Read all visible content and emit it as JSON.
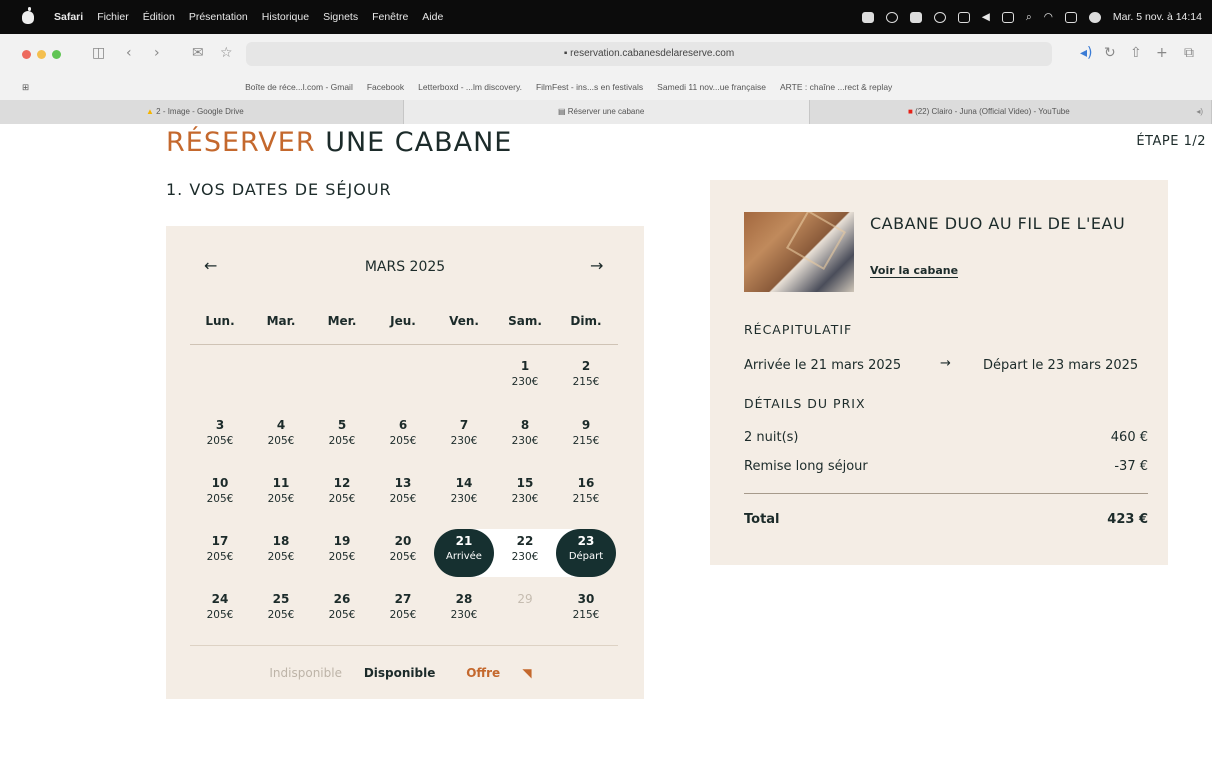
{
  "menubar": {
    "app": "Safari",
    "items": [
      "Fichier",
      "Édition",
      "Présentation",
      "Historique",
      "Signets",
      "Fenêtre",
      "Aide"
    ],
    "clock": "Mar. 5 nov. à 14:14"
  },
  "browser": {
    "url": "reservation.cabanesdelareserve.com",
    "favorites": [
      "Boîte de réce...l.com - Gmail",
      "Facebook",
      "Letterboxd - ...lm discovery.",
      "FilmFest - ins...s en festivals",
      "Samedi 11 nov...ue française",
      "ARTE : chaîne ...rect & replay"
    ],
    "tabs": [
      "2 - Image - Google Drive",
      "Réserver une cabane",
      "(22) Clairo - Juna (Official Video) - YouTube"
    ]
  },
  "page": {
    "title_accent": "RÉSERVER",
    "title_rest": "UNE CABANE",
    "step": "ÉTAPE 1/2",
    "section": "1. VOS DATES DE SÉJOUR"
  },
  "calendar": {
    "month": "MARS 2025",
    "prev": "←",
    "next": "→",
    "weekdays": [
      "Lun.",
      "Mar.",
      "Mer.",
      "Jeu.",
      "Ven.",
      "Sam.",
      "Dim."
    ],
    "days": [
      {
        "n": "1",
        "p": "230€"
      },
      {
        "n": "2",
        "p": "215€"
      },
      {
        "n": "3",
        "p": "205€"
      },
      {
        "n": "4",
        "p": "205€"
      },
      {
        "n": "5",
        "p": "205€"
      },
      {
        "n": "6",
        "p": "205€"
      },
      {
        "n": "7",
        "p": "230€"
      },
      {
        "n": "8",
        "p": "230€"
      },
      {
        "n": "9",
        "p": "215€"
      },
      {
        "n": "10",
        "p": "205€"
      },
      {
        "n": "11",
        "p": "205€"
      },
      {
        "n": "12",
        "p": "205€"
      },
      {
        "n": "13",
        "p": "205€"
      },
      {
        "n": "14",
        "p": "230€"
      },
      {
        "n": "15",
        "p": "230€"
      },
      {
        "n": "16",
        "p": "215€"
      },
      {
        "n": "17",
        "p": "205€"
      },
      {
        "n": "18",
        "p": "205€"
      },
      {
        "n": "19",
        "p": "205€"
      },
      {
        "n": "20",
        "p": "205€"
      },
      {
        "n": "21",
        "p": "Arrivée"
      },
      {
        "n": "22",
        "p": "230€"
      },
      {
        "n": "23",
        "p": "Départ"
      },
      {
        "n": "24",
        "p": "205€"
      },
      {
        "n": "25",
        "p": "205€"
      },
      {
        "n": "26",
        "p": "205€"
      },
      {
        "n": "27",
        "p": "205€"
      },
      {
        "n": "28",
        "p": "230€"
      },
      {
        "n": "29",
        "p": ""
      },
      {
        "n": "30",
        "p": "215€"
      }
    ],
    "legend": {
      "unavailable": "Indisponible",
      "available": "Disponible",
      "offer": "Offre"
    }
  },
  "summary": {
    "cabin": "CABANE DUO AU FIL DE L'EAU",
    "link": "Voir la cabane",
    "recap": "RÉCAPITULATIF",
    "arrival": "Arrivée le 21 mars 2025",
    "arrow": "→",
    "departure": "Départ le 23 mars 2025",
    "details": "DÉTAILS DU PRIX",
    "nights_label": "2 nuit(s)",
    "nights_price": "460 €",
    "discount_label": "Remise long séjour",
    "discount": "-37 €",
    "total_label": "Total",
    "total": "423 €"
  },
  "colors": {
    "accent": "#c4682d",
    "dark": "#163030",
    "panel": "#f4ede5"
  }
}
